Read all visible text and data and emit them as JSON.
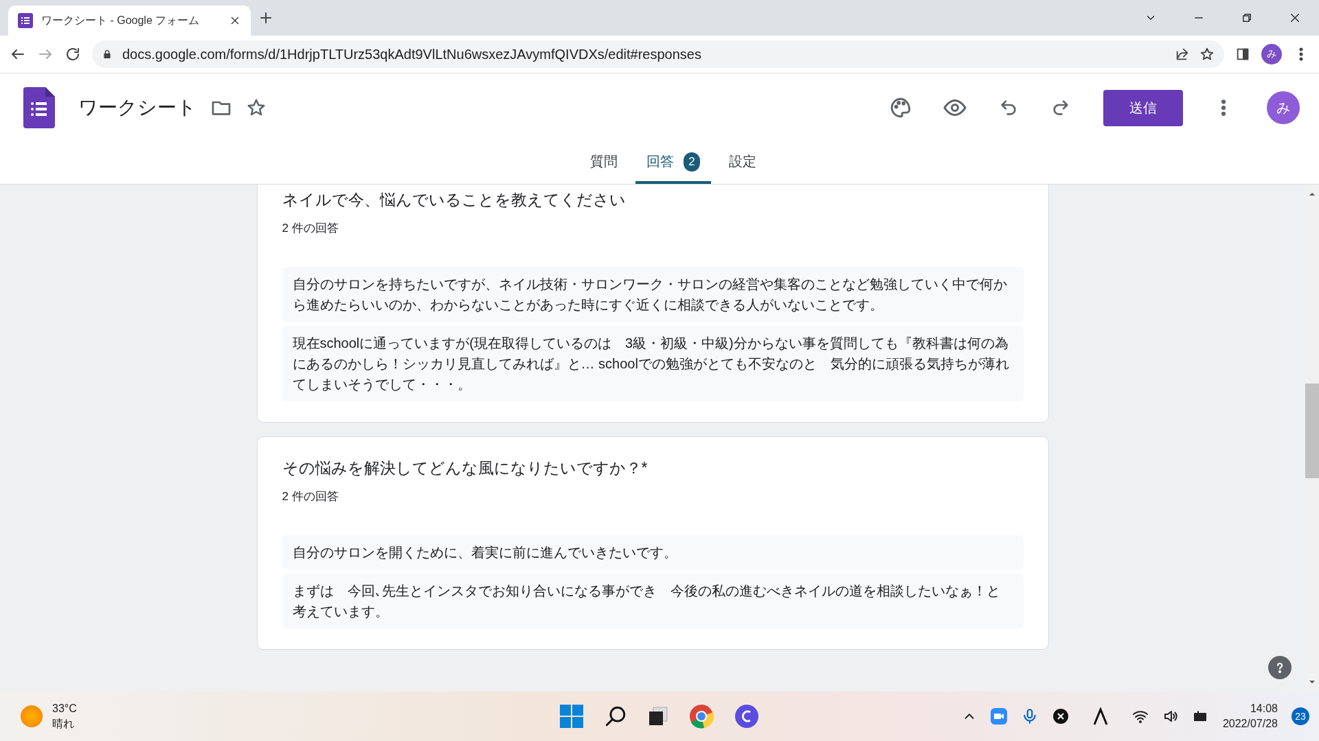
{
  "browser": {
    "tab_title": "ワークシート - Google フォーム",
    "url": "docs.google.com/forms/d/1HdrjpTLTUrz53qkAdt9VlLtNu6wsxezJAvymfQIVDXs/edit#responses",
    "profile": "み"
  },
  "form": {
    "title": "ワークシート",
    "send_button": "送信",
    "avatar": "み"
  },
  "tabs": [
    {
      "label": "質問",
      "selected": false
    },
    {
      "label": "回答",
      "badge": "2",
      "selected": true
    },
    {
      "label": "設定",
      "selected": false
    }
  ],
  "questions": [
    {
      "title": "ネイルで今、悩んでいることを教えてください",
      "count": "2 件の回答",
      "responses": [
        "自分のサロンを持ちたいですが、ネイル技術・サロンワーク・サロンの経営や集客のことなど勉強していく中で何から進めたらいいのか、わからないことがあった時にすぐ近くに相談できる人がいないことです。",
        "現在schoolに通っていますが(現在取得しているのは　3級・初級・中級)分からない事を質問しても『教科書は何の為にあるのかしら！シッカリ見直してみれば』と… schoolでの勉強がとても不安なのと　気分的に頑張る気持ちが薄れてしまいそうでして・・・。"
      ]
    },
    {
      "title": "その悩みを解決してどんな風になりたいですか？*",
      "count": "2 件の回答",
      "responses": [
        "自分のサロンを開くために、着実に前に進んでいきたいです。",
        "まずは　今回､先生とインスタでお知り合いになる事ができ　今後の私の進むべきネイルの道を相談したいなぁ！と考えています。"
      ]
    }
  ],
  "taskbar": {
    "temperature": "33°C",
    "weather": "晴れ",
    "time": "14:08",
    "date": "2022/07/28",
    "notifications": "23"
  }
}
